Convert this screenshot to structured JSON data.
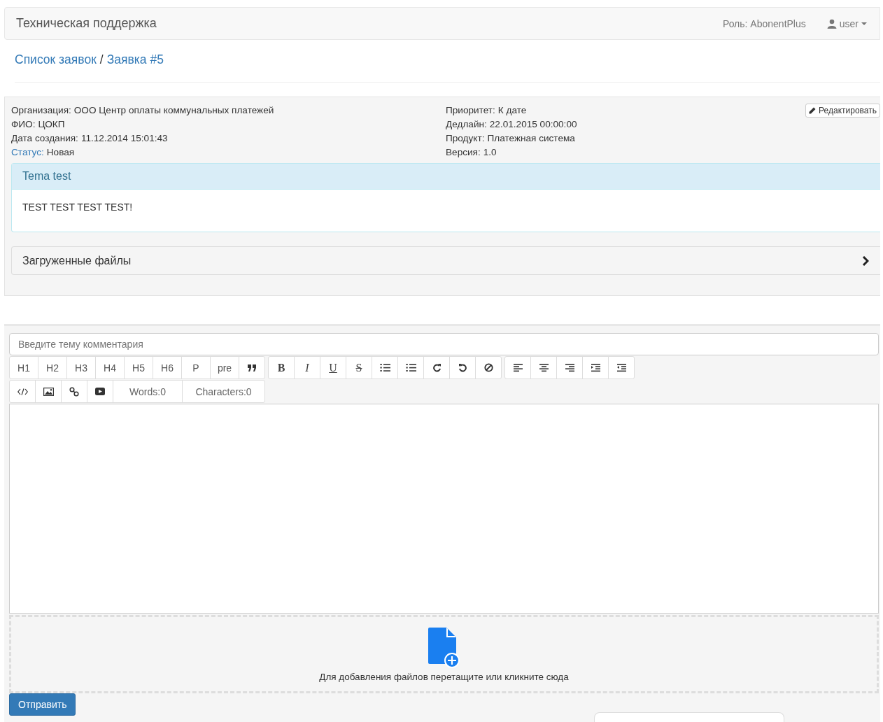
{
  "navbar": {
    "brand": "Техническая поддержка",
    "role": "Роль: AbonentPlus",
    "user": "user"
  },
  "breadcrumb": [
    {
      "label": "Список заявок"
    },
    {
      "label": "Заявка #5"
    }
  ],
  "breadcrumb_separator": "/",
  "ticket": {
    "left": [
      {
        "label": "Организация:",
        "value": "ООО Центр оплаты коммунальных платежей",
        "highlight": false
      },
      {
        "label": "ФИО:",
        "value": "ЦОКП",
        "highlight": false
      },
      {
        "label": "Дата создания:",
        "value": "11.12.2014 15:01:43",
        "highlight": false
      },
      {
        "label": "Статус:",
        "value": "Новая",
        "highlight": true
      }
    ],
    "right": [
      {
        "label": "Приоритет:",
        "value": "К дате",
        "highlight": false
      },
      {
        "label": "Дедлайн:",
        "value": "22.01.2015 00:00:00",
        "highlight": false
      },
      {
        "label": "Продукт:",
        "value": "Платежная система",
        "highlight": false
      },
      {
        "label": "Версия:",
        "value": "1.0",
        "highlight": false
      }
    ],
    "edit_button": "Редактировать",
    "message": {
      "title": "Tema test",
      "body": "TEST TEST TEST TEST!"
    },
    "files": {
      "title": "Загруженные файлы",
      "expanded": false
    }
  },
  "comment": {
    "subject_placeholder": "Введите тему комментария",
    "toolbar": [
      [
        {
          "kind": "text",
          "label": "H1"
        },
        {
          "kind": "text",
          "label": "H2"
        },
        {
          "kind": "text",
          "label": "H3"
        },
        {
          "kind": "text",
          "label": "H4"
        },
        {
          "kind": "text",
          "label": "H5"
        },
        {
          "kind": "text",
          "label": "H6"
        },
        {
          "kind": "text",
          "label": "P"
        },
        {
          "kind": "text",
          "label": "pre"
        },
        {
          "kind": "quote"
        }
      ],
      [
        {
          "kind": "bold",
          "label": "B"
        },
        {
          "kind": "italic",
          "label": "I"
        },
        {
          "kind": "underline",
          "label": "U"
        },
        {
          "kind": "strike",
          "label": "S"
        },
        {
          "kind": "ul"
        },
        {
          "kind": "ol"
        },
        {
          "kind": "redo"
        },
        {
          "kind": "undo"
        },
        {
          "kind": "clear"
        }
      ],
      [
        {
          "kind": "align-left"
        },
        {
          "kind": "align-center"
        },
        {
          "kind": "align-right"
        },
        {
          "kind": "indent"
        },
        {
          "kind": "outdent"
        }
      ],
      [
        {
          "kind": "code"
        },
        {
          "kind": "image"
        },
        {
          "kind": "link"
        },
        {
          "kind": "video"
        },
        {
          "kind": "counter",
          "label": "Words:0"
        },
        {
          "kind": "counter",
          "label": "Characters:0"
        }
      ]
    ],
    "dropzone_text": "Для добавления файлов перетащите или кликните сюда",
    "submit": "Отправить"
  }
}
